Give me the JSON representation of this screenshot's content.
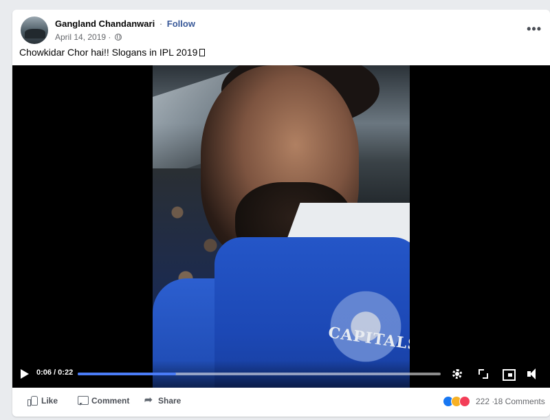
{
  "post": {
    "author": "Gangland Chandanwari",
    "separator": "·",
    "follow_label": "Follow",
    "date": "April 14, 2019 ·",
    "more_label": "•••",
    "text": "Chowkidar Chor hai!! Slogans in IPL 2019"
  },
  "video": {
    "time_display": "0:06 / 0:22",
    "progress": 0.27,
    "shirt_print": "CAPITALS"
  },
  "actions": {
    "like_label": "Like",
    "comment_label": "Comment",
    "share_label": "Share",
    "reaction_count": "222",
    "separator": "·",
    "comments_count": "18 Comments"
  },
  "colors": {
    "link": "#385898",
    "progress_fill": "#4a7cf7",
    "shirt_blue": "#1c48b5"
  },
  "icons": [
    "globe-icon",
    "more-options-icon",
    "play-icon",
    "settings-icon",
    "fullscreen-icon",
    "pip-icon",
    "mute-icon",
    "like-icon",
    "comment-icon",
    "share-icon",
    "like-reaction-icon",
    "haha-reaction-icon",
    "love-reaction-icon"
  ]
}
